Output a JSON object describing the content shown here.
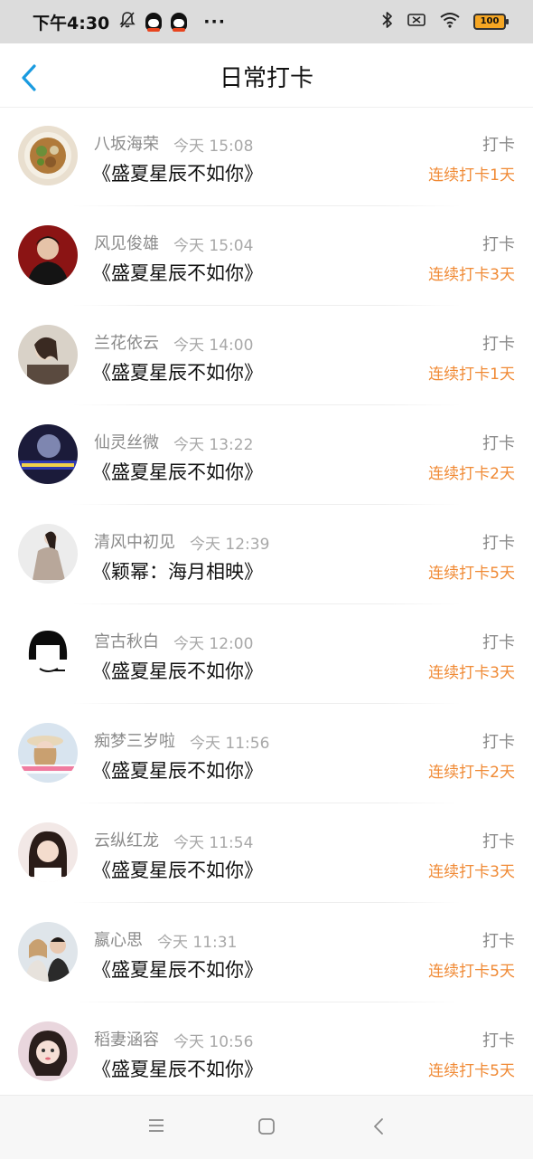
{
  "status_bar": {
    "time": "下午4:30",
    "dots": "···",
    "battery": "100",
    "icons": [
      "mute-bell-icon",
      "qq-icon",
      "qq-icon",
      "bluetooth-icon",
      "sim-off-icon",
      "wifi-icon",
      "battery-icon"
    ]
  },
  "header": {
    "title": "日常打卡",
    "back_icon": "chevron-left-icon"
  },
  "colors": {
    "accent_blue": "#1a9be0",
    "streak_orange": "#f08a35",
    "name_gray": "#8a8a8a",
    "time_gray": "#a8a8a8"
  },
  "items": [
    {
      "name": "八坂海荣",
      "time": "今天 15:08",
      "book": "《盛夏星辰不如你》",
      "action": "打卡",
      "streak": "连续打卡1天",
      "avatar": "food-plate-avatar"
    },
    {
      "name": "风见俊雄",
      "time": "今天 15:04",
      "book": "《盛夏星辰不如你》",
      "action": "打卡",
      "streak": "连续打卡3天",
      "avatar": "man-portrait-avatar"
    },
    {
      "name": "兰花依云",
      "time": "今天 14:00",
      "book": "《盛夏星辰不如你》",
      "action": "打卡",
      "streak": "连续打卡1天",
      "avatar": "girl-sepia-avatar"
    },
    {
      "name": "仙灵丝微",
      "time": "今天 13:22",
      "book": "《盛夏星辰不如你》",
      "action": "打卡",
      "streak": "连续打卡2天",
      "avatar": "dark-banner-avatar"
    },
    {
      "name": "清风中初见",
      "time": "今天 12:39",
      "book": "《颖幂：海月相映》",
      "action": "打卡",
      "streak": "连续打卡5天",
      "avatar": "dress-figure-avatar"
    },
    {
      "name": "宫古秋白",
      "time": "今天 12:00",
      "book": "《盛夏星辰不如你》",
      "action": "打卡",
      "streak": "连续打卡3天",
      "avatar": "black-hair-cartoon-avatar"
    },
    {
      "name": "痴梦三岁啦",
      "time": "今天 11:56",
      "book": "《盛夏星辰不如你》",
      "action": "打卡",
      "streak": "连续打卡2天",
      "avatar": "girl-hat-avatar"
    },
    {
      "name": "云纵红龙",
      "time": "今天 11:54",
      "book": "《盛夏星辰不如你》",
      "action": "打卡",
      "streak": "连续打卡3天",
      "avatar": "girl-selfie-avatar"
    },
    {
      "name": "嬴心思",
      "time": "今天 11:31",
      "book": "《盛夏星辰不如你》",
      "action": "打卡",
      "streak": "连续打卡5天",
      "avatar": "couple-avatar"
    },
    {
      "name": "稻妻涵容",
      "time": "今天 10:56",
      "book": "《盛夏星辰不如你》",
      "action": "打卡",
      "streak": "连续打卡5天",
      "avatar": "girl-pink-avatar"
    }
  ],
  "nav_bar": {
    "icons": [
      "menu-icon",
      "home-square-icon",
      "back-triangle-icon"
    ]
  }
}
